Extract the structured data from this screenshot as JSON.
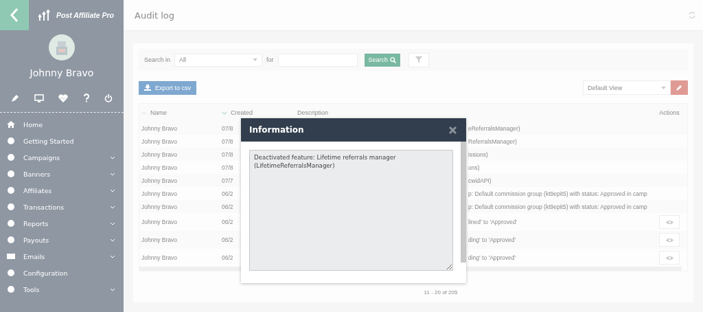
{
  "sidebar": {
    "logo": "Post Affiliate Pro",
    "user_name": "Johnny Bravo",
    "menu": [
      {
        "label": "Home",
        "expandable": false
      },
      {
        "label": "Getting Started",
        "expandable": false
      },
      {
        "label": "Campaigns",
        "expandable": true
      },
      {
        "label": "Banners",
        "expandable": true
      },
      {
        "label": "Affiliates",
        "expandable": true
      },
      {
        "label": "Transactions",
        "expandable": true
      },
      {
        "label": "Reports",
        "expandable": true
      },
      {
        "label": "Payouts",
        "expandable": true
      },
      {
        "label": "Emails",
        "expandable": true
      },
      {
        "label": "Configuration",
        "expandable": false
      },
      {
        "label": "Tools",
        "expandable": true
      }
    ]
  },
  "header": {
    "title": "Audit log"
  },
  "search": {
    "label": "Search in",
    "scope": "All",
    "for_label": "for",
    "button": "Search"
  },
  "export_button": "Export to csv",
  "view_select": "Default View",
  "table": {
    "columns": [
      "Name",
      "Created",
      "Description",
      "Actions"
    ],
    "rows": [
      {
        "name": "Johnny Bravo",
        "created": "07/8",
        "description": "eReferralsManager)",
        "view_button": false
      },
      {
        "name": "Johnny Bravo",
        "created": "07/8",
        "description": "ReferralsManager)",
        "view_button": false
      },
      {
        "name": "Johnny Bravo",
        "created": "07/8",
        "description": "issions)",
        "view_button": false
      },
      {
        "name": "Johnny Bravo",
        "created": "07/8",
        "description": "ons)",
        "view_button": false
      },
      {
        "name": "Johnny Bravo",
        "created": "07/7",
        "description": "cwidAPI)",
        "view_button": false
      },
      {
        "name": "Johnny Bravo",
        "created": "06/2",
        "description": "p: Default commission group (kt9epit5) with status: Approved in camp",
        "view_button": false
      },
      {
        "name": "Johnny Bravo",
        "created": "06/2",
        "description": "p: Default commission group (kt9epit5) with status: Approved in camp",
        "view_button": false
      },
      {
        "name": "Johnny Bravo",
        "created": "06/2",
        "description": "lined' to 'Approved'",
        "view_button": true
      },
      {
        "name": "Johnny Bravo",
        "created": "06/2",
        "description": "ding' to 'Approved'",
        "view_button": true
      },
      {
        "name": "Johnny Bravo",
        "created": "06/2",
        "description": "ding' to 'Approved'",
        "view_button": true
      }
    ],
    "pagination": "11 - 20 of 205"
  },
  "dialog": {
    "title": "Information",
    "text": "Deactivated feature: Lifetime referrals manager\n(LifetimeReferralsManager)"
  }
}
